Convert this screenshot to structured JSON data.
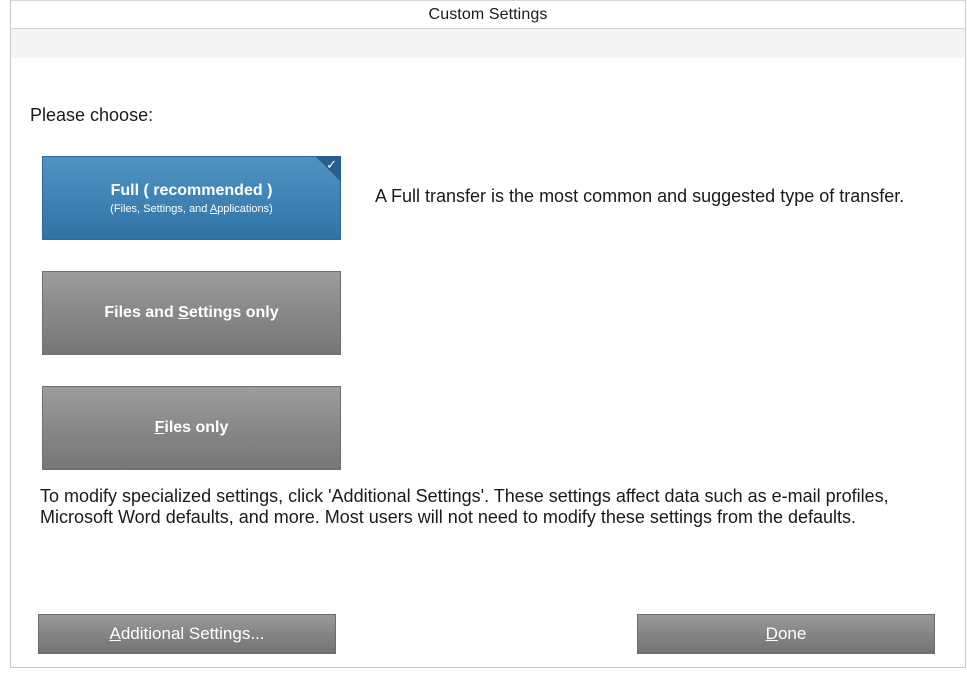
{
  "dialog": {
    "title": "Custom Settings"
  },
  "prompt": "Please choose:",
  "options": [
    {
      "pre": "Full ( recommended )",
      "sub_pre": "(Files, Settings, and ",
      "sub_mnemonic": "A",
      "sub_post": "pplications)",
      "selected": true,
      "description": "A Full transfer is the most common and suggested type of transfer."
    },
    {
      "pre": "Files and ",
      "mnemonic": "S",
      "post": "ettings only",
      "selected": false
    },
    {
      "pre": "",
      "mnemonic": "F",
      "post": "iles only",
      "selected": false
    }
  ],
  "info_text": "To modify specialized settings, click 'Additional Settings'. These settings affect data such as e-mail profiles, Microsoft Word defaults, and more. Most users will not need to modify these settings from the defaults.",
  "buttons": {
    "additional": {
      "mnemonic": "A",
      "post": "dditional Settings..."
    },
    "done": {
      "mnemonic": "D",
      "post": "one"
    }
  },
  "icons": {
    "check": "checkmark-icon"
  },
  "colors": {
    "selected_option": "#3f84b5",
    "option": "#8a8a8a",
    "button": "#858585"
  }
}
